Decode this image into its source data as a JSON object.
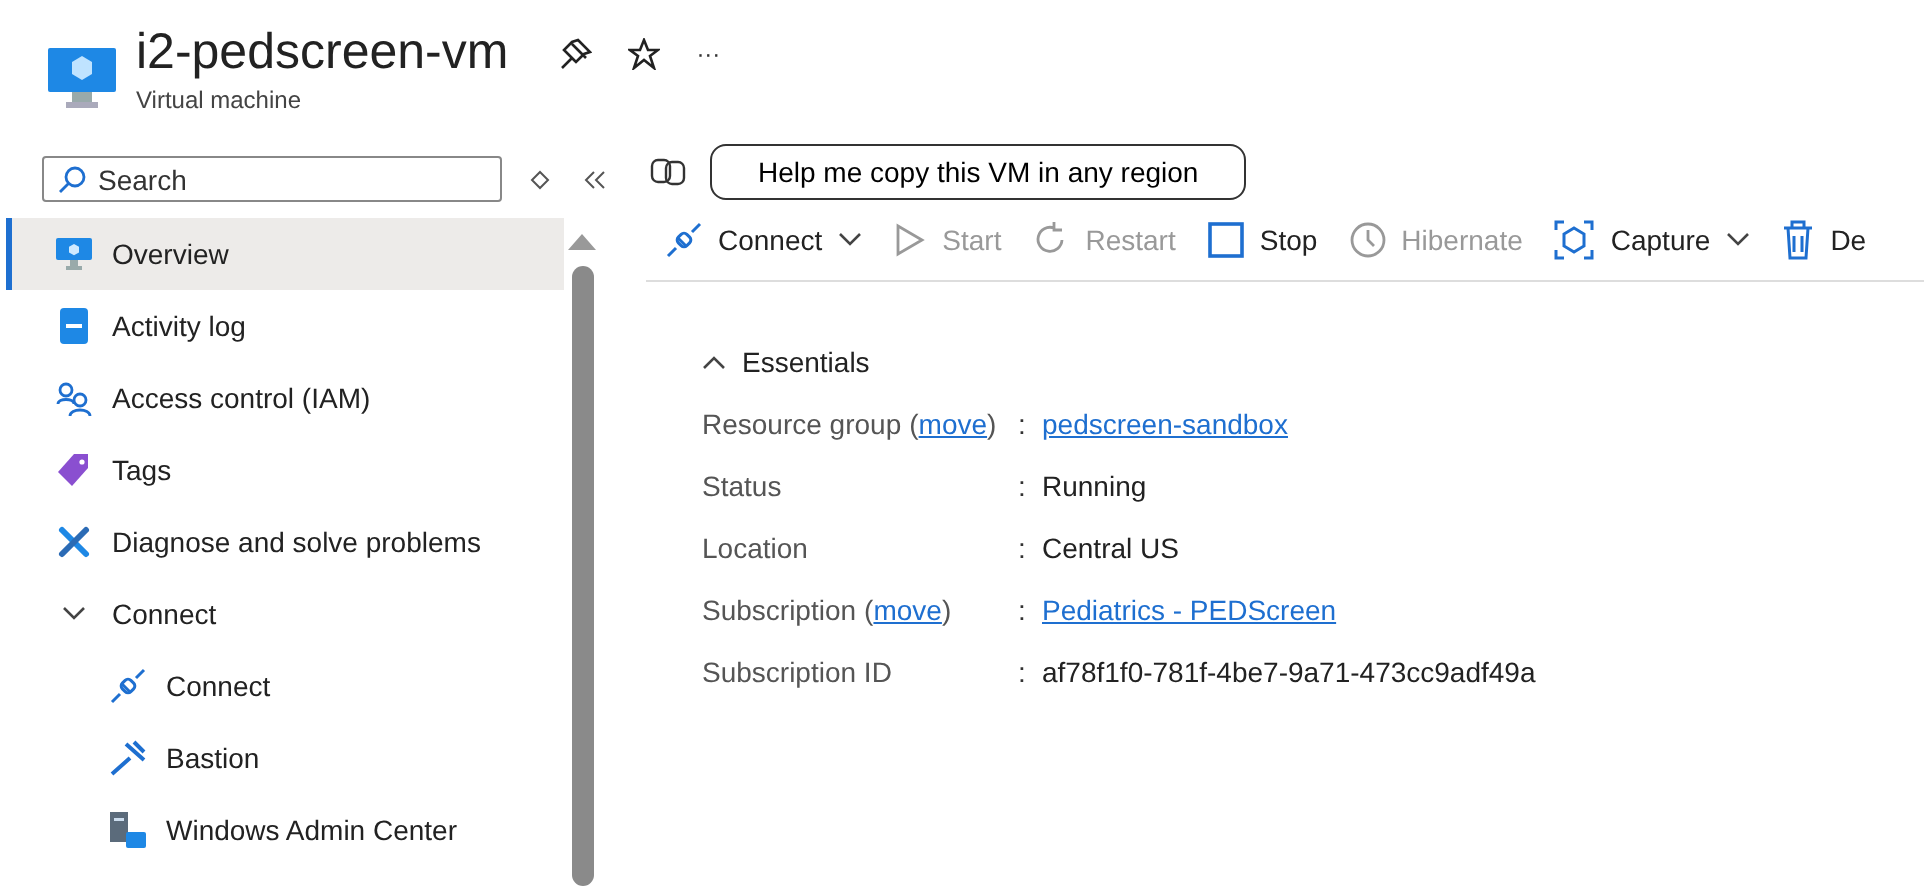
{
  "header": {
    "title": "i2-pedscreen-vm",
    "subtitle": "Virtual machine",
    "more": "···"
  },
  "sidebar": {
    "search": {
      "placeholder": "Search"
    },
    "items": [
      {
        "label": "Overview",
        "kind": "monitor",
        "selected": true
      },
      {
        "label": "Activity log",
        "kind": "log",
        "selected": false
      },
      {
        "label": "Access control (IAM)",
        "kind": "people",
        "selected": false
      },
      {
        "label": "Tags",
        "kind": "tag",
        "selected": false
      },
      {
        "label": "Diagnose and solve problems",
        "kind": "tools",
        "selected": false
      },
      {
        "label": "Connect",
        "kind": "group",
        "selected": false,
        "expanded": true,
        "children": [
          {
            "label": "Connect",
            "kind": "plug",
            "selected": false
          },
          {
            "label": "Bastion",
            "kind": "bastion",
            "selected": false
          },
          {
            "label": "Windows Admin Center",
            "kind": "server",
            "selected": false
          }
        ]
      }
    ]
  },
  "copilot_prompt": "Help me copy this VM in any region",
  "toolbar": [
    {
      "label": "Connect",
      "kind": "plug",
      "disabled": false,
      "dropdown": true
    },
    {
      "label": "Start",
      "kind": "play",
      "disabled": true,
      "dropdown": false
    },
    {
      "label": "Restart",
      "kind": "restart",
      "disabled": true,
      "dropdown": false
    },
    {
      "label": "Stop",
      "kind": "stop",
      "disabled": false,
      "dropdown": false
    },
    {
      "label": "Hibernate",
      "kind": "clock",
      "disabled": true,
      "dropdown": false
    },
    {
      "label": "Capture",
      "kind": "capture",
      "disabled": false,
      "dropdown": true
    },
    {
      "label": "De",
      "kind": "trash",
      "disabled": false,
      "dropdown": false
    }
  ],
  "essentials": {
    "title": "Essentials",
    "expanded": true,
    "rows": [
      {
        "label": "Resource group",
        "move": {
          "open": "(",
          "link": "move",
          "close": ")"
        },
        "sep": ":",
        "value": "pedscreen-sandbox",
        "kind": "link"
      },
      {
        "label": "Status",
        "sep": ":",
        "value": "Running",
        "kind": "text"
      },
      {
        "label": "Location",
        "sep": ":",
        "value": "Central US",
        "kind": "text"
      },
      {
        "label": "Subscription",
        "move": {
          "open": "(",
          "link": "move",
          "close": ")"
        },
        "sep": ":",
        "value": "Pediatrics - PEDScreen",
        "kind": "link"
      },
      {
        "label": "Subscription ID",
        "sep": ":",
        "value": "af78f1f0-781f-4be7-9a71-473cc9adf49a",
        "kind": "text"
      }
    ]
  }
}
